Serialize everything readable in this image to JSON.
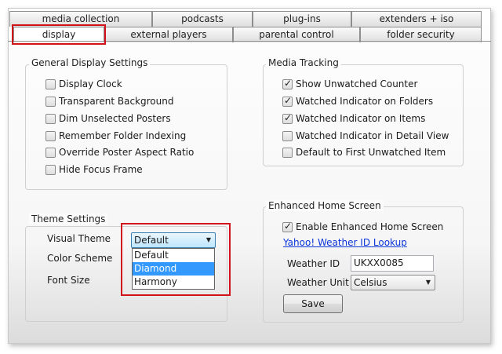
{
  "tabs_row1": [
    {
      "label": "media collection"
    },
    {
      "label": "podcasts"
    },
    {
      "label": "plug-ins"
    },
    {
      "label": "extenders + iso"
    }
  ],
  "tabs_row2": [
    {
      "label": "display"
    },
    {
      "label": "external players"
    },
    {
      "label": "parental control"
    },
    {
      "label": "folder security"
    }
  ],
  "general_display": {
    "title": "General Display Settings",
    "options": [
      {
        "label": "Display Clock",
        "checked": false
      },
      {
        "label": "Transparent Background",
        "checked": false
      },
      {
        "label": "Dim Unselected Posters",
        "checked": false
      },
      {
        "label": "Remember Folder Indexing",
        "checked": false
      },
      {
        "label": "Override Poster Aspect Ratio",
        "checked": false
      },
      {
        "label": "Hide Focus Frame",
        "checked": false
      }
    ]
  },
  "media_tracking": {
    "title": "Media Tracking",
    "options": [
      {
        "label": "Show Unwatched Counter",
        "checked": true
      },
      {
        "label": "Watched Indicator on Folders",
        "checked": true
      },
      {
        "label": "Watched Indicator on Items",
        "checked": true
      },
      {
        "label": "Watched Indicator in Detail View",
        "checked": false
      },
      {
        "label": "Default to First Unwatched Item",
        "checked": false
      }
    ]
  },
  "theme_settings": {
    "title": "Theme Settings",
    "visual_theme_label": "Visual Theme",
    "visual_theme_value": "Default",
    "visual_theme_options": [
      "Default",
      "Diamond",
      "Harmony"
    ],
    "highlighted_option": "Diamond",
    "color_scheme_label": "Color Scheme",
    "font_size_label": "Font Size"
  },
  "enhanced_home": {
    "title": "Enhanced Home Screen",
    "enable_label": "Enable Enhanced Home Screen",
    "enable_checked": true,
    "weather_link": "Yahoo! Weather ID Lookup",
    "weather_id_label": "Weather ID",
    "weather_id_value": "UKXX0085",
    "weather_unit_label": "Weather Unit",
    "weather_unit_value": "Celsius",
    "save_label": "Save"
  },
  "colors": {
    "highlight": "#d2121b",
    "link": "#0b35d9",
    "selection": "#3399ff"
  }
}
